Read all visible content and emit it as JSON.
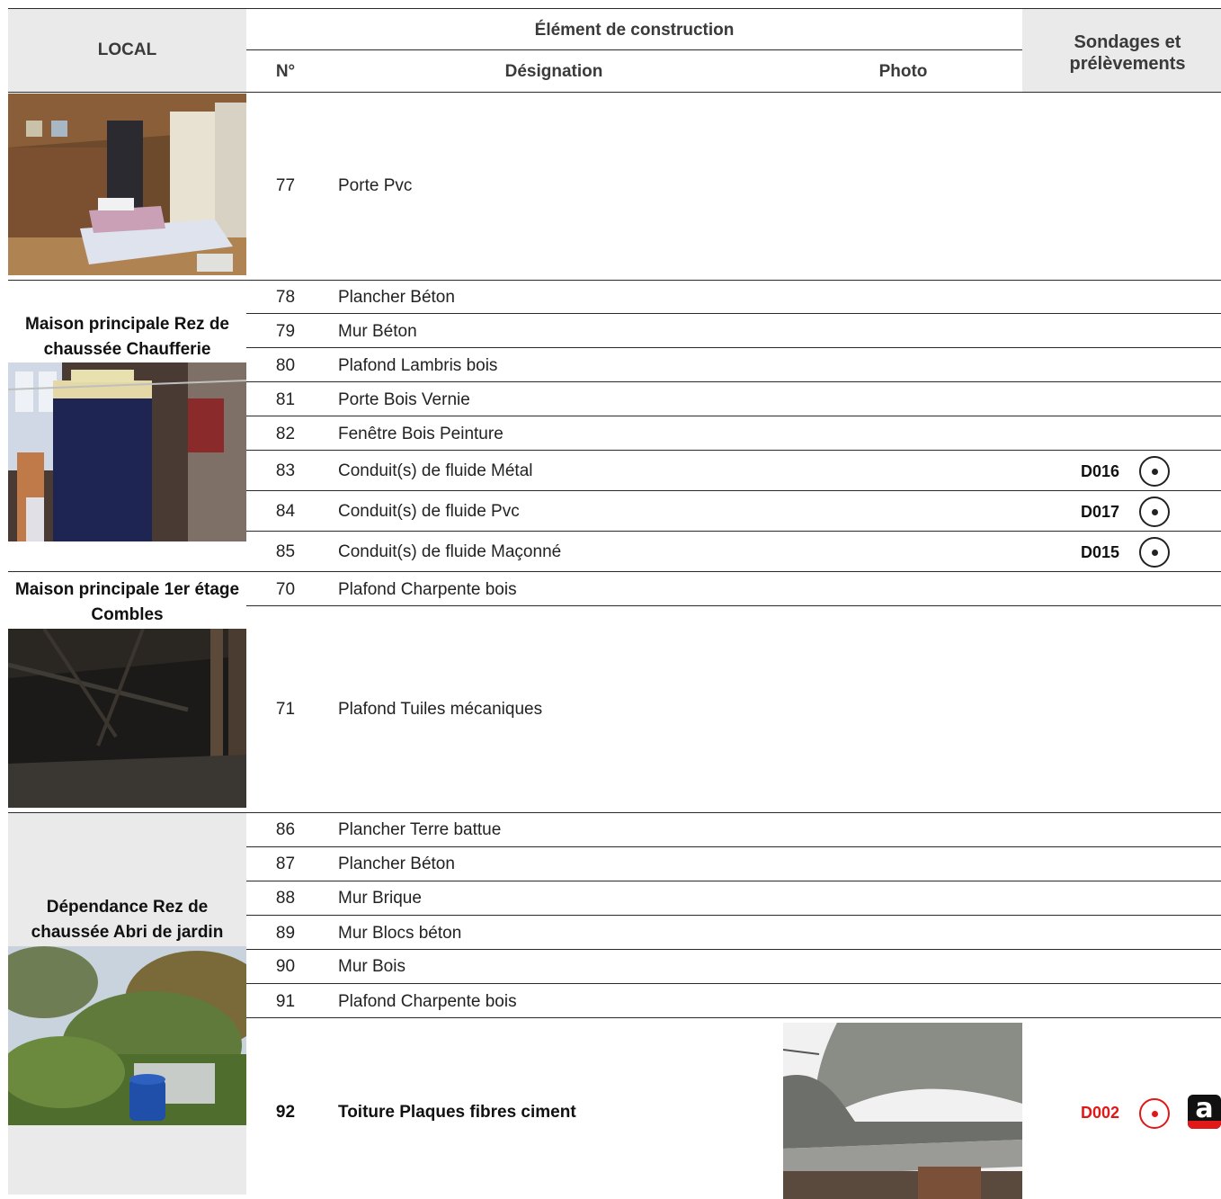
{
  "header": {
    "local": "LOCAL",
    "element": "Élément de construction",
    "num": "N°",
    "designation": "Désignation",
    "photo": "Photo",
    "sondages": "Sondages et prélèvements"
  },
  "locals": [
    {
      "name": "",
      "rows": [
        {
          "num": "77",
          "designation": "Porte Pvc"
        }
      ]
    },
    {
      "name": "Maison principale Rez de chaussée Chaufferie",
      "rows": [
        {
          "num": "78",
          "designation": "Plancher Béton"
        },
        {
          "num": "79",
          "designation": "Mur Béton"
        },
        {
          "num": "80",
          "designation": "Plafond Lambris bois"
        },
        {
          "num": "81",
          "designation": "Porte Bois Vernie"
        },
        {
          "num": "82",
          "designation": "Fenêtre Bois Peinture"
        },
        {
          "num": "83",
          "designation": "Conduit(s) de fluide Métal",
          "code": "D016"
        },
        {
          "num": "84",
          "designation": "Conduit(s) de fluide Pvc",
          "code": "D017"
        },
        {
          "num": "85",
          "designation": "Conduit(s) de fluide Maçonné",
          "code": "D015"
        }
      ]
    },
    {
      "name": "Maison principale 1er étage Combles",
      "rows": [
        {
          "num": "70",
          "designation": "Plafond Charpente bois"
        },
        {
          "num": "71",
          "designation": "Plafond Tuiles mécaniques"
        }
      ]
    },
    {
      "name": "Dépendance Rez de chaussée Abri de jardin",
      "rows": [
        {
          "num": "86",
          "designation": "Plancher Terre battue"
        },
        {
          "num": "87",
          "designation": "Plancher Béton"
        },
        {
          "num": "88",
          "designation": "Mur Brique"
        },
        {
          "num": "89",
          "designation": "Mur Blocs béton"
        },
        {
          "num": "90",
          "designation": "Mur Bois"
        },
        {
          "num": "91",
          "designation": "Plafond Charpente bois"
        },
        {
          "num": "92",
          "designation": "Toiture Plaques fibres ciment",
          "code": "D002",
          "asbestos_logo": "a"
        }
      ]
    }
  ],
  "colors": {
    "asbestos_red": "#e01818",
    "header_gray": "#eaeaea"
  }
}
